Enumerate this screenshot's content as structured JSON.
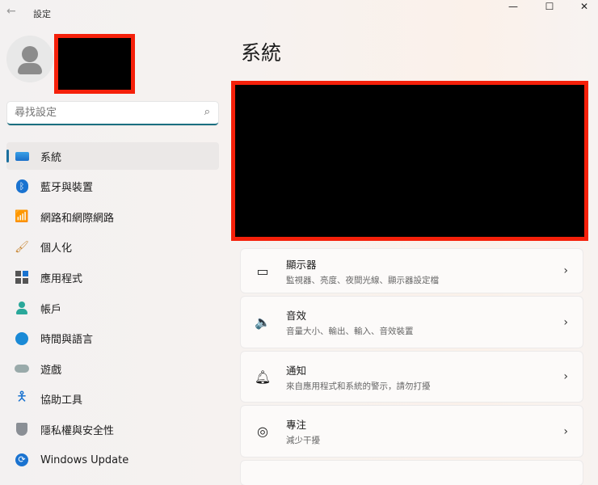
{
  "window": {
    "title": "設定",
    "back_icon": "arrow-left-icon",
    "controls": [
      "minimize",
      "maximize",
      "close"
    ]
  },
  "search": {
    "placeholder": "尋找設定"
  },
  "sidebar": {
    "items": [
      {
        "label": "系統",
        "icon": "monitor-icon",
        "active": true
      },
      {
        "label": "藍牙與裝置",
        "icon": "bluetooth-icon"
      },
      {
        "label": "網路和網際網路",
        "icon": "wifi-icon"
      },
      {
        "label": "個人化",
        "icon": "brush-icon"
      },
      {
        "label": "應用程式",
        "icon": "apps-icon"
      },
      {
        "label": "帳戶",
        "icon": "person-icon"
      },
      {
        "label": "時間與語言",
        "icon": "globe-clock-icon"
      },
      {
        "label": "遊戲",
        "icon": "gamepad-icon"
      },
      {
        "label": "協助工具",
        "icon": "accessibility-icon"
      },
      {
        "label": "隱私權與安全性",
        "icon": "shield-icon"
      },
      {
        "label": "Windows Update",
        "icon": "update-icon"
      }
    ]
  },
  "main": {
    "title": "系統",
    "cards": [
      {
        "title": "顯示器",
        "subtitle": "監視器、亮度、夜間光線、顯示器設定檔",
        "icon": "laptop-icon"
      },
      {
        "title": "音效",
        "subtitle": "音量大小、輸出、輸入、音效裝置",
        "icon": "speaker-icon"
      },
      {
        "title": "通知",
        "subtitle": "來自應用程式和系統的警示，請勿打擾",
        "icon": "bell-icon"
      },
      {
        "title": "專注",
        "subtitle": "減少干擾",
        "icon": "focus-icon"
      }
    ]
  }
}
